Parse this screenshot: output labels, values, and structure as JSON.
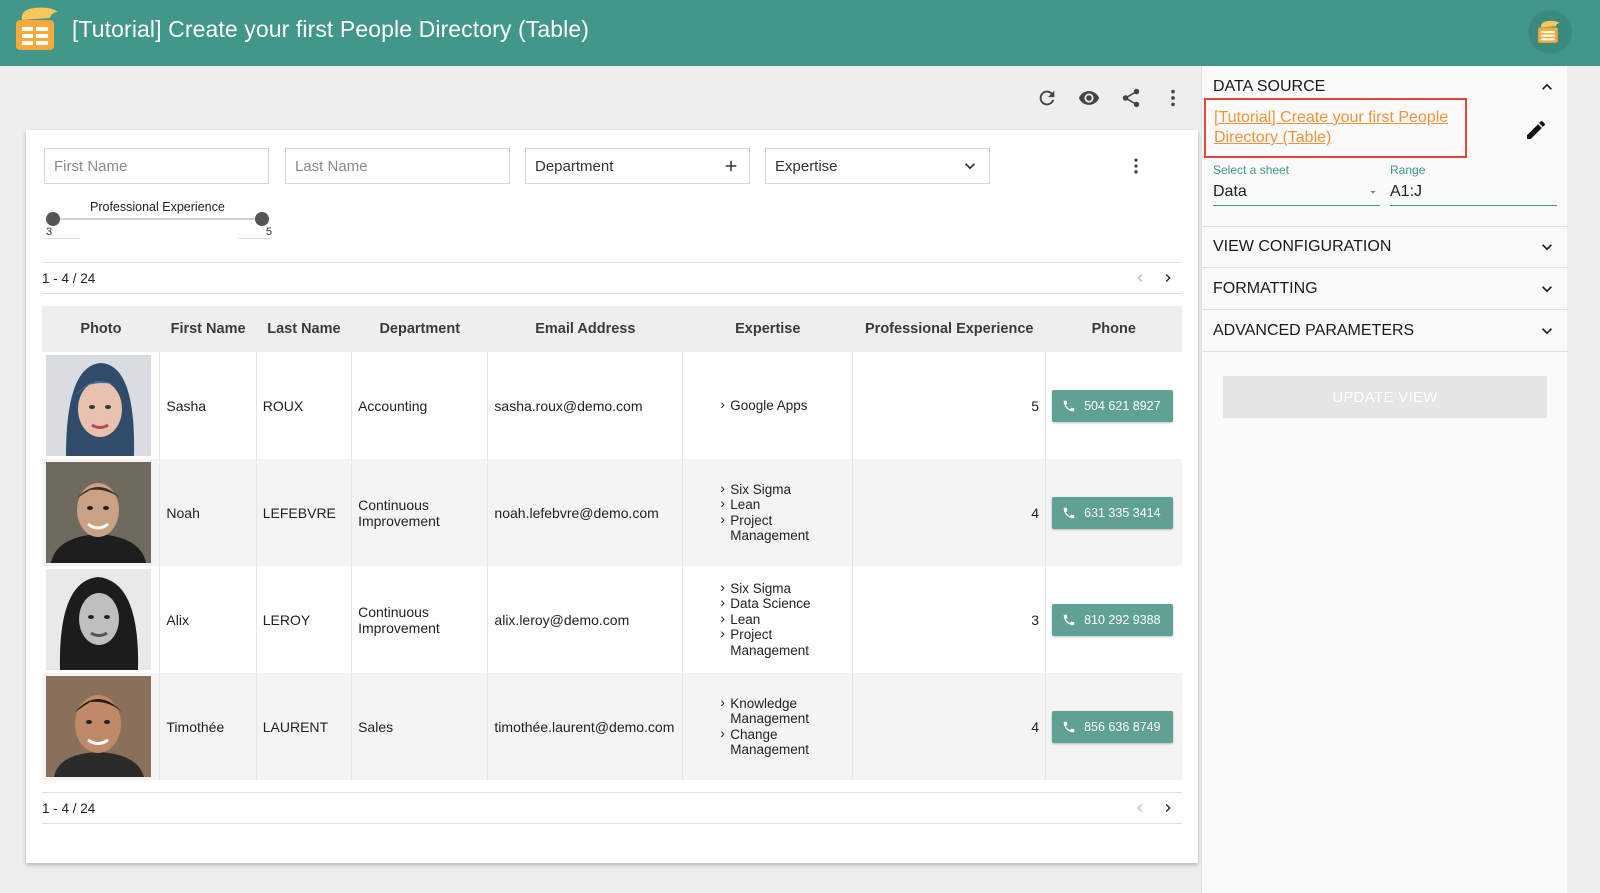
{
  "header": {
    "title": "[Tutorial] Create your first People Directory (Table)"
  },
  "toolbar": {
    "icons": [
      "refresh-icon",
      "eye-icon",
      "share-icon",
      "more-vert-icon"
    ]
  },
  "filters": {
    "first_name_placeholder": "First Name",
    "last_name_placeholder": "Last Name",
    "department_label": "Department",
    "expertise_label": "Expertise",
    "slider_label": "Professional Experience",
    "slider_min": "3",
    "slider_max": "5"
  },
  "pager": {
    "text": "1 - 4 / 24"
  },
  "table": {
    "headers": [
      "Photo",
      "First Name",
      "Last Name",
      "Department",
      "Email Address",
      "Expertise",
      "Professional Experience",
      "Phone"
    ],
    "rows": [
      {
        "first": "Sasha",
        "last": "ROUX",
        "dept": "Accounting",
        "email": "sasha.roux@demo.com",
        "expertise": [
          "Google Apps"
        ],
        "exp": "5",
        "phone": "504 621 8927"
      },
      {
        "first": "Noah",
        "last": "LEFEBVRE",
        "dept": "Continuous Improvement",
        "email": "noah.lefebvre@demo.com",
        "expertise": [
          "Six Sigma",
          "Lean",
          "Project Management"
        ],
        "exp": "4",
        "phone": "631 335 3414"
      },
      {
        "first": "Alix",
        "last": "LEROY",
        "dept": "Continuous Improvement",
        "email": "alix.leroy@demo.com",
        "expertise": [
          "Six Sigma",
          "Data Science",
          "Lean",
          "Project Management"
        ],
        "exp": "3",
        "phone": "810 292 9388"
      },
      {
        "first": "Timothée",
        "last": "LAURENT",
        "dept": "Sales",
        "email": "timothée.laurent@demo.com",
        "expertise": [
          "Knowledge Management",
          "Change Management"
        ],
        "exp": "4",
        "phone": "856 636 8749"
      }
    ]
  },
  "panel": {
    "data_source": "DATA SOURCE",
    "link": "[Tutorial] Create your first People Directory (Table)",
    "sheet_label": "Select a sheet",
    "sheet_value": "Data",
    "range_label": "Range",
    "range_value": "A1:J",
    "view_config": "VIEW CONFIGURATION",
    "formatting": "FORMATTING",
    "advanced": "ADVANCED PARAMETERS",
    "update": "UPDATE VIEW"
  },
  "colors": {
    "header": "#40978a",
    "phone_button": "#60a196",
    "link": "#f0933a",
    "highlight_box": "#e5483a"
  }
}
